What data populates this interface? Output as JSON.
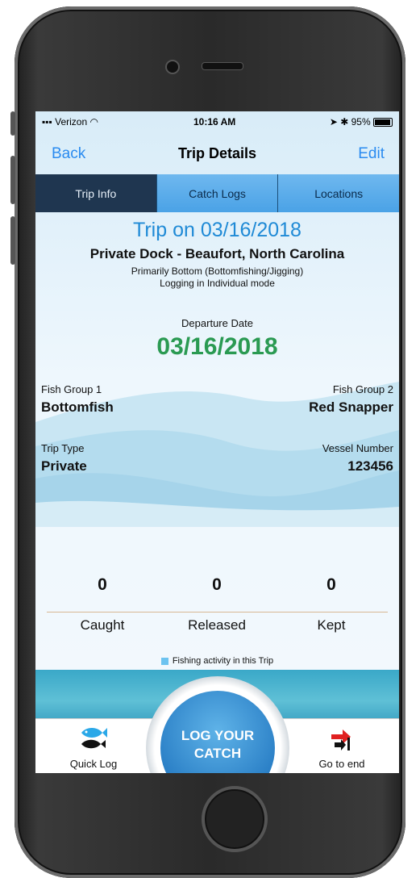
{
  "status": {
    "carrier": "Verizon",
    "time": "10:16 AM",
    "battery": "95%"
  },
  "nav": {
    "back": "Back",
    "title": "Trip Details",
    "edit": "Edit"
  },
  "tabs": [
    {
      "label": "Trip Info",
      "active": true
    },
    {
      "label": "Catch Logs",
      "active": false
    },
    {
      "label": "Locations",
      "active": false
    }
  ],
  "trip": {
    "title": "Trip on 03/16/2018",
    "dock": "Private Dock -  Beaufort, North Carolina",
    "method": "Primarily Bottom (Bottomfishing/Jigging)",
    "mode": "Logging in Individual mode",
    "departure_label": "Departure Date",
    "departure_date": "03/16/2018",
    "fish_group_1_label": "Fish Group 1",
    "fish_group_1": "Bottomfish",
    "fish_group_2_label": "Fish Group 2",
    "fish_group_2": "Red Snapper",
    "trip_type_label": "Trip Type",
    "trip_type": "Private",
    "vessel_label": "Vessel Number",
    "vessel_number": "123456"
  },
  "stats": {
    "caught_value": "0",
    "caught_label": "Caught",
    "released_value": "0",
    "released_label": "Released",
    "kept_value": "0",
    "kept_label": "Kept"
  },
  "legend": "Fishing activity in this Trip",
  "bottom": {
    "quick_log": "Quick Log",
    "log_line1": "LOG YOUR",
    "log_line2": "CATCH",
    "go_to_end": "Go to end"
  },
  "colors": {
    "accent": "#2a8bf0",
    "title_blue": "#1f8ad6",
    "date_green": "#2a9a52",
    "tab_active": "#1f3650"
  }
}
